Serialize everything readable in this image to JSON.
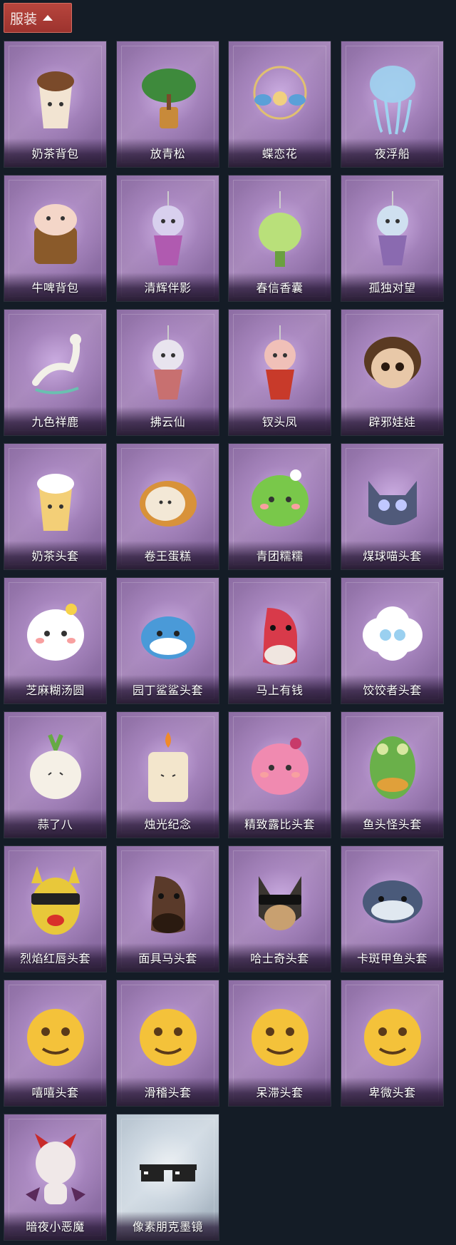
{
  "header": {
    "title": "服装"
  },
  "colors": {
    "card_purple": "#9a7bb2",
    "card_silver": "#c3ced8",
    "header_red": "#a83a34",
    "background": "#141c26"
  },
  "items": [
    {
      "name": "奶茶背包",
      "icon": "milk-tea-backpack-icon"
    },
    {
      "name": "放青松",
      "icon": "bonsai-pine-icon"
    },
    {
      "name": "蝶恋花",
      "icon": "butterfly-ornament-icon"
    },
    {
      "name": "夜浮船",
      "icon": "jellyfish-charm-icon"
    },
    {
      "name": "牛啤背包",
      "icon": "cow-beer-backpack-icon"
    },
    {
      "name": "清辉伴影",
      "icon": "silver-hair-doll-icon"
    },
    {
      "name": "春信香囊",
      "icon": "green-sachet-icon"
    },
    {
      "name": "孤独对望",
      "icon": "doll-charm-icon"
    },
    {
      "name": "九色祥鹿",
      "icon": "deer-charm-icon"
    },
    {
      "name": "拂云仙",
      "icon": "immortal-charm-icon"
    },
    {
      "name": "钗头凤",
      "icon": "phoenix-crown-doll-icon"
    },
    {
      "name": "辟邪娃娃",
      "icon": "doll-head-icon"
    },
    {
      "name": "奶茶头套",
      "icon": "milk-tea-head-icon"
    },
    {
      "name": "卷王蛋糕",
      "icon": "roll-cake-head-icon"
    },
    {
      "name": "青团糯糯",
      "icon": "green-dumpling-head-icon"
    },
    {
      "name": "煤球喵头套",
      "icon": "black-cat-head-icon"
    },
    {
      "name": "芝麻糊汤圆",
      "icon": "rice-ball-head-icon"
    },
    {
      "name": "园丁鲨鲨头套",
      "icon": "shark-head-icon"
    },
    {
      "name": "马上有钱",
      "icon": "red-horse-head-icon"
    },
    {
      "name": "饺饺者头套",
      "icon": "cloud-head-icon"
    },
    {
      "name": "蒜了八",
      "icon": "garlic-head-icon"
    },
    {
      "name": "烛光纪念",
      "icon": "candle-head-icon"
    },
    {
      "name": "精致露比头套",
      "icon": "pink-beaver-head-icon"
    },
    {
      "name": "鱼头怪头套",
      "icon": "fish-head-icon"
    },
    {
      "name": "烈焰红唇头套",
      "icon": "yellow-mask-head-icon"
    },
    {
      "name": "面具马头套",
      "icon": "horse-mask-icon"
    },
    {
      "name": "哈士奇头套",
      "icon": "husky-head-icon"
    },
    {
      "name": "卡斑甲鱼头套",
      "icon": "whale-head-icon"
    },
    {
      "name": "嘻嘻头套",
      "icon": "grin-emoji-head-icon"
    },
    {
      "name": "滑稽头套",
      "icon": "funny-emoji-head-icon"
    },
    {
      "name": "呆滞头套",
      "icon": "dazed-emoji-head-icon"
    },
    {
      "name": "卑微头套",
      "icon": "humble-emoji-head-icon"
    },
    {
      "name": "暗夜小恶魔",
      "icon": "little-devil-icon"
    },
    {
      "name": "像素朋克墨镜",
      "icon": "pixel-sunglasses-icon"
    }
  ]
}
